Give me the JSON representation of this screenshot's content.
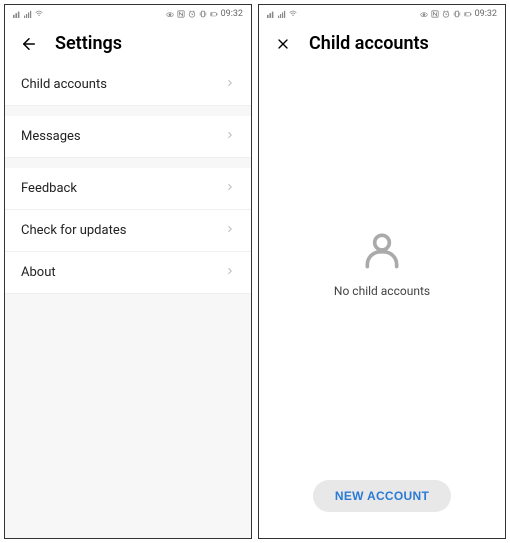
{
  "status": {
    "time": "09:32"
  },
  "screen1": {
    "title": "Settings",
    "items": [
      {
        "label": "Child accounts"
      },
      {
        "label": "Messages"
      },
      {
        "label": "Feedback"
      },
      {
        "label": "Check for updates"
      },
      {
        "label": "About"
      }
    ]
  },
  "screen2": {
    "title": "Child accounts",
    "empty_text": "No child accounts",
    "new_button": "NEW ACCOUNT"
  }
}
